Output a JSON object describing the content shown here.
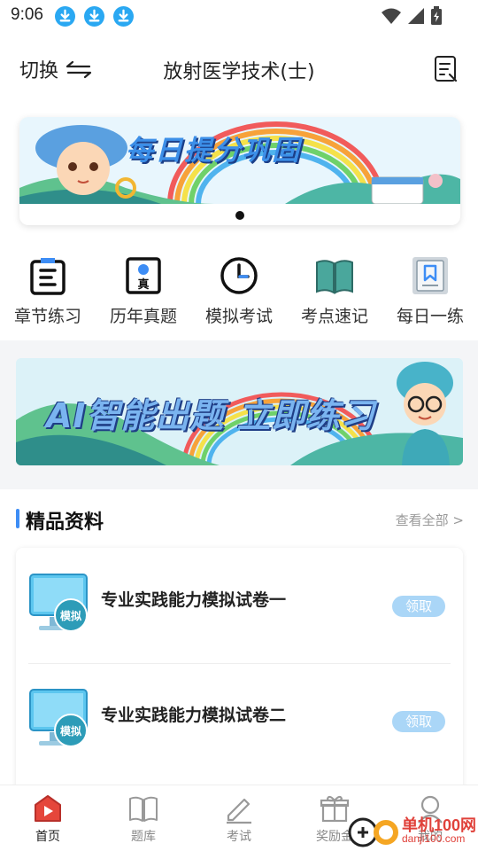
{
  "status_bar": {
    "time": "9:06"
  },
  "header": {
    "switch_label": "切换",
    "title": "放射医学技术(士)"
  },
  "banner": {
    "title": "每日提分巩固"
  },
  "quick_menu": [
    {
      "label": "章节练习",
      "icon": "chapter-practice-icon"
    },
    {
      "label": "历年真题",
      "icon": "past-exam-icon"
    },
    {
      "label": "模拟考试",
      "icon": "clock-icon"
    },
    {
      "label": "考点速记",
      "icon": "open-book-icon"
    },
    {
      "label": "每日一练",
      "icon": "bookmark-book-icon"
    }
  ],
  "ai_banner": {
    "title": "AI智能出题 立即练习"
  },
  "materials": {
    "title": "精品资料",
    "view_all": "查看全部 >",
    "items": [
      {
        "title": "专业实践能力模拟试卷一",
        "badge": "模拟",
        "action": "领取"
      },
      {
        "title": "专业实践能力模拟试卷二",
        "badge": "模拟",
        "action": "领取"
      }
    ]
  },
  "tabs": [
    {
      "label": "首页",
      "icon": "home-play-icon",
      "active": true
    },
    {
      "label": "题库",
      "icon": "book-icon",
      "active": false
    },
    {
      "label": "考试",
      "icon": "pencil-icon",
      "active": false
    },
    {
      "label": "奖励金",
      "icon": "gift-icon",
      "active": false
    },
    {
      "label": "我的",
      "icon": "profile-icon",
      "active": false
    }
  ],
  "watermark": {
    "text": "单机100网",
    "url": "danji100.com"
  },
  "colors": {
    "accent": "#3d8df5",
    "active_tab": "#e5463b",
    "claim_button": "#aad6f7"
  }
}
